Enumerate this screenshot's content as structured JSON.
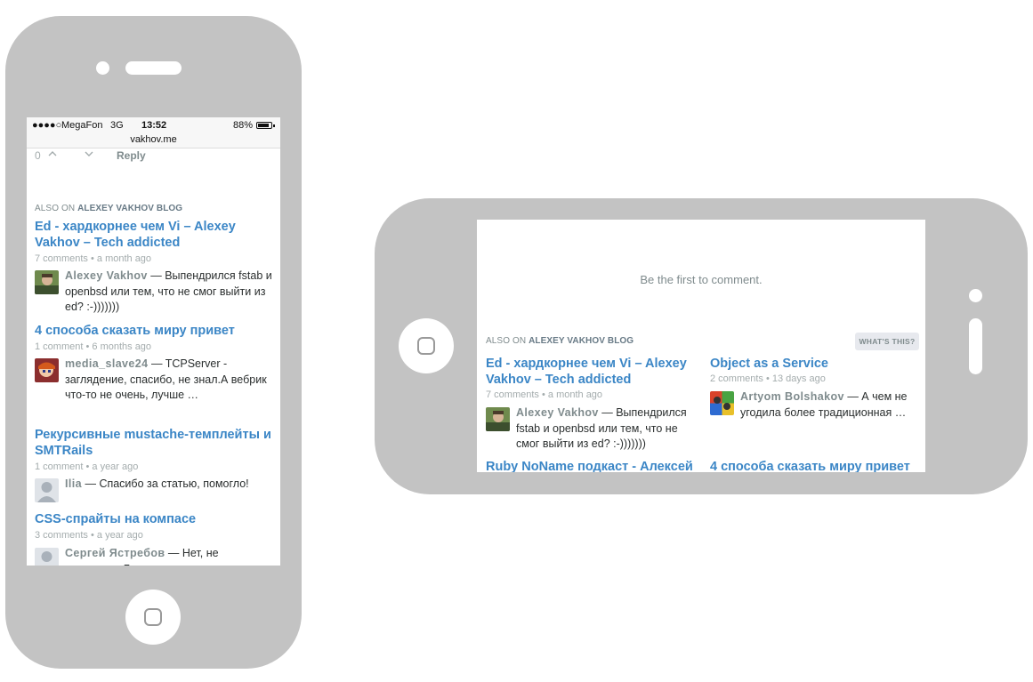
{
  "portrait": {
    "status_bar": {
      "signal": "●●●●○",
      "carrier": "MegaFon",
      "network": "3G",
      "time": "13:52",
      "battery_percent": "88%",
      "battery_level": 0.88,
      "url": "vakhov.me"
    },
    "vote_row": {
      "count": "0",
      "upvote_icon": "chevron-up-icon",
      "downvote_icon": "chevron-down-icon",
      "reply_label": "Reply"
    },
    "also_on": {
      "prefix": "ALSO ON",
      "site": "ALEXEY VAKHOV BLOG"
    },
    "discussions": [
      {
        "title": "Ed - хардкорнее чем Vi – Alexey Vakhov – Tech addicted",
        "comments": "7 comments",
        "age": "a month ago",
        "author": "Alexey Vakhov",
        "text": "Выпендрился fstab и openbsd или тем, что не смог выйти из ed? :-)))))))"
      },
      {
        "title": "4 способа сказать миру привет",
        "comments": "1 comment",
        "age": "6 months ago",
        "author": "media_slave24",
        "text": "TCPServer - заглядение, спасибо, не знал.А вебрик что-то не очень, лучше …"
      },
      {
        "title": "Рекурсивные mustache-темплейты и SMTRails",
        "comments": "1 comment",
        "age": "a year ago",
        "author": "Ilia",
        "text": "Спасибо за статью, помогло!"
      },
      {
        "title": "CSS-спрайты на компасе",
        "comments": "3 comments",
        "age": "a year ago",
        "author": "Сергей Ястребов",
        "text": "Нет, не учитывает. Генератор пытает уложить"
      }
    ]
  },
  "landscape": {
    "empty_message": "Be the first to comment.",
    "also_on": {
      "prefix": "ALSO ON",
      "site": "ALEXEY VAKHOV BLOG"
    },
    "whats_this": "WHAT'S THIS?",
    "discussions": [
      {
        "title": "Ed - хардкорнее чем Vi – Alexey Vakhov – Tech addicted",
        "comments": "7 comments",
        "age": "a month ago",
        "author": "Alexey Vakhov",
        "text": "Выпендрился fstab и openbsd или тем, что не смог выйти из ed? :-)))))))"
      },
      {
        "title": "Object as a Service",
        "comments": "2 comments",
        "age": "13 days ago",
        "author": "Artyom Bolshakov",
        "text": "А чем не угодила более традиционная …"
      },
      {
        "title": "Ruby NoName подкаст - Алексей",
        "comments": "",
        "age": "",
        "author": "",
        "text": ""
      },
      {
        "title": "4 способа сказать миру привет",
        "comments": "",
        "age": "",
        "author": "",
        "text": ""
      }
    ]
  },
  "colors": {
    "phone_body": "#c3c3c3",
    "link": "#3b86c6",
    "muted": "#a4acad",
    "author": "#7f8b8d",
    "text": "#2a2e2e"
  },
  "icons": {
    "home_button": "home-square-icon",
    "camera": "front-camera-icon",
    "speaker": "speaker-grille-icon"
  }
}
